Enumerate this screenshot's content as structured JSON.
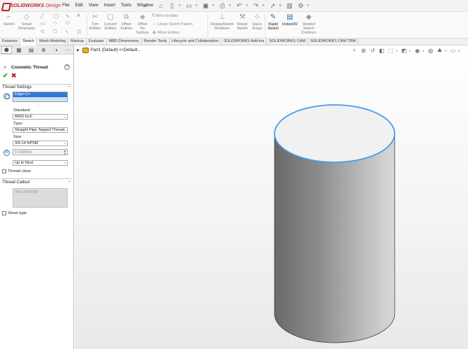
{
  "app": {
    "brand": "SOLIDWORKS",
    "brand_suffix": "Design",
    "menu": [
      "File",
      "Edit",
      "View",
      "Insert",
      "Tools",
      "Window"
    ]
  },
  "ribbon": {
    "sketch": "Sketch",
    "smart_dimension": [
      "Smart",
      "Dimension"
    ],
    "trim": [
      "Trim",
      "Entities"
    ],
    "convert": [
      "Convert",
      "Entities"
    ],
    "offset_entities": [
      "Offset",
      "Entities"
    ],
    "offset_surface": [
      "Offset",
      "On",
      "Surface"
    ],
    "mirror": "Mirror Entities",
    "linear_pattern": "Linear Sketch Pattern",
    "move": "Move Entities",
    "display_relations": [
      "Display/Delete",
      "Relations"
    ],
    "repair": [
      "Repair",
      "Sketch"
    ],
    "quick_snaps": [
      "Quick",
      "Snaps"
    ],
    "rapid_sketch": [
      "Rapid",
      "Sketch"
    ],
    "instant2d": "Instant2D",
    "shaded_contours": [
      "Shaded",
      "Sketch",
      "Contours"
    ]
  },
  "tabs": [
    "Features",
    "Sketch",
    "Mesh Modeling",
    "Markup",
    "Evaluate",
    "MBD Dimensions",
    "Render Tools",
    "Lifecycle and Collaboration",
    "SOLIDWORKS Add-Ins",
    "SOLIDWORKS CAM",
    "SOLIDWORKS CAM TBM"
  ],
  "active_tab": "Sketch",
  "property_manager": {
    "title": "Cosmetic Thread",
    "thread_settings": "Thread Settings",
    "edge_item": "Edge<1>",
    "standard_label": "Standard:",
    "standard_value": "ANSI Inch",
    "type_label": "Type:",
    "type_value": "Straight Pipe Tapped Thread",
    "size_label": "Size:",
    "size_value": "3/4-14 NPSM",
    "depth_value": "0.93890in",
    "end_condition": "Up to Next",
    "thread_class": "Thread class",
    "thread_callout": "Thread Callout",
    "callout_text": "3/4-14 NPSM",
    "show_type": "Show type"
  },
  "viewport": {
    "crumb": "Part1 (Default) <<Default...",
    "colors": {
      "edge_highlight": "#4a9be8",
      "cylinder_dark": "#6e6e6e",
      "cylinder_light": "#d6d6d6",
      "top_face": "#f1f1f1"
    }
  }
}
